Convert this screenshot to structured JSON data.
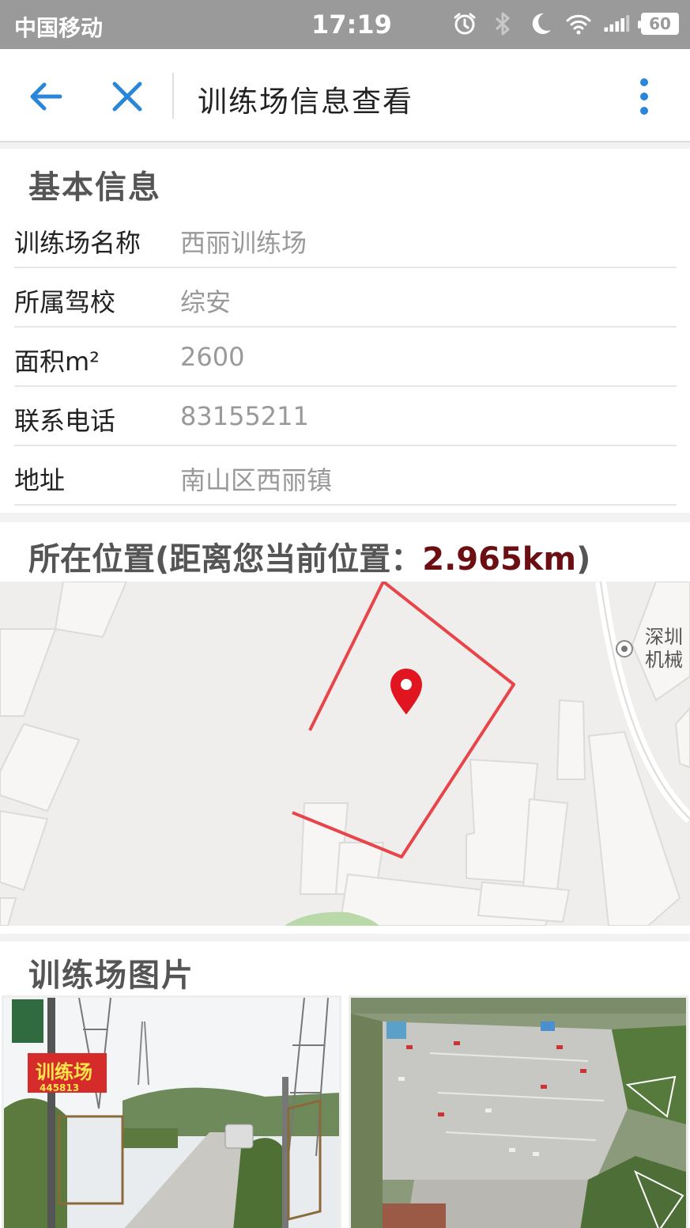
{
  "status_bar": {
    "carrier": "中国移动",
    "time": "17:19",
    "battery": "60",
    "icons": [
      "alarm-icon",
      "bluetooth-icon",
      "moon-icon",
      "wifi-icon",
      "signal-icon",
      "battery-icon"
    ]
  },
  "nav": {
    "title": "训练场信息查看",
    "back_icon": "arrow-left-icon",
    "close_icon": "close-icon",
    "more_icon": "more-vertical-icon",
    "accent_color": "#2a86d8"
  },
  "basic_info": {
    "title": "基本信息",
    "rows": [
      {
        "label": "训练场名称",
        "value": "西丽训练场"
      },
      {
        "label": "所属驾校",
        "value": "综安"
      },
      {
        "label": "面积m²",
        "value": "2600"
      },
      {
        "label": "联系电话",
        "value": "83155211"
      },
      {
        "label": "地址",
        "value": "南山区西丽镇"
      }
    ]
  },
  "location": {
    "title_prefix": "所在位置(距离您当前位置：",
    "distance": "2.965km",
    "title_suffix": ")",
    "map_poi_line1": "深圳",
    "map_poi_line2": "机械",
    "boundary_color": "#e8454a",
    "distance_color": "#6b0f12"
  },
  "photos": {
    "title": "训练场图片",
    "sign_text": "训练场",
    "sign_phone": "445813"
  }
}
